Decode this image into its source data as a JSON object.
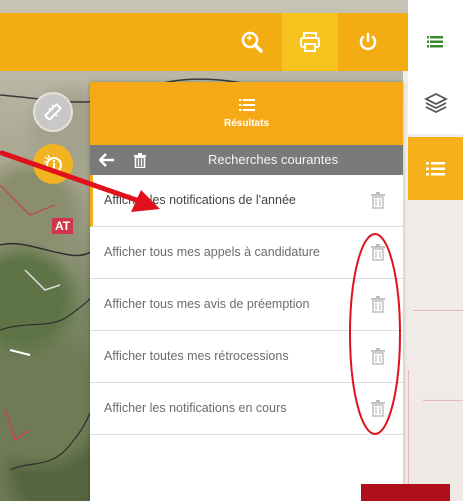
{
  "topbar": {
    "search_icon": "search-icon",
    "print_icon": "print-icon",
    "power_icon": "power-icon"
  },
  "right_panel": {
    "menu_icon": "menu-icon",
    "layers_icon": "layers-icon",
    "results_icon": "list-icon"
  },
  "map": {
    "label": "AT"
  },
  "panel": {
    "title": "Résultats",
    "subheader": "Recherches courantes",
    "items": [
      {
        "label": "Afficher les notifications de l'année"
      },
      {
        "label": "Afficher tous mes appels à candidature"
      },
      {
        "label": "Afficher tous mes avis de préemption"
      },
      {
        "label": "Afficher toutes mes rétrocessions"
      },
      {
        "label": "Afficher les notifications en cours"
      }
    ]
  },
  "colors": {
    "accent": "#f3ad13",
    "accent_active": "#f8c31f",
    "subheader": "#7a7a7a",
    "annotation": "#e0111b"
  }
}
